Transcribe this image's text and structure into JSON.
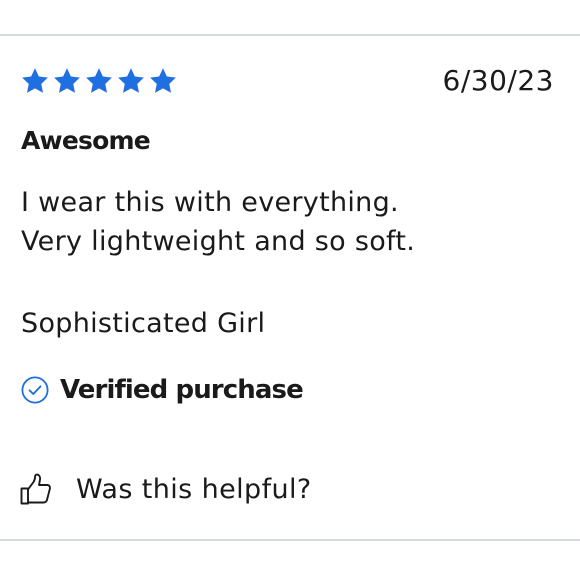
{
  "review": {
    "rating": 5,
    "rating_max": 5,
    "date": "6/30/23",
    "title": "Awesome",
    "body_lines": [
      "I wear this with everything.",
      "Very lightweight and so soft."
    ],
    "author": "Sophisticated Girl",
    "verified_label": "Verified purchase",
    "helpful_label": "Was this helpful?"
  },
  "colors": {
    "star": "#1f6fe0",
    "check": "#1f6fe0",
    "text": "#1a1a1a",
    "divider": "#d6d9dd"
  },
  "icons": {
    "star": "star-icon",
    "verified": "check-circle-icon",
    "helpful": "thumbs-up-icon"
  }
}
